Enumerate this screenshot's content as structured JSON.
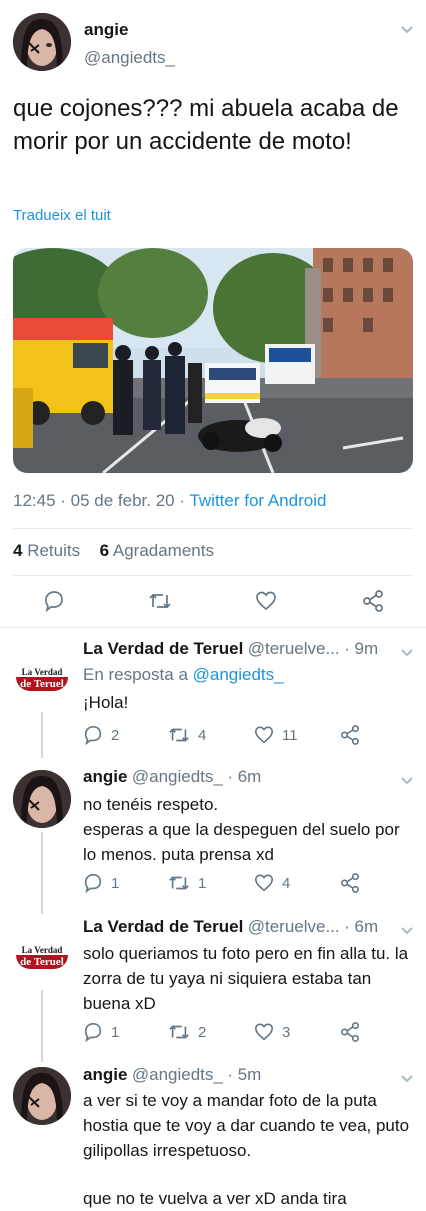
{
  "main_tweet": {
    "name": "angie",
    "handle": "@angiedts_",
    "text": "que cojones??? mi abuela acaba de morir por un accidente de moto!",
    "translate": "Tradueix el tuit",
    "image_alt": "accident scene with ambulance, police and motorcycle on street",
    "time": "12:45 · 05 de febr. 20 · ",
    "source": "Twitter for Android",
    "retweets_count": "4",
    "retweets_label": "Retuits",
    "likes_count": "6",
    "likes_label": "Agradaments"
  },
  "replies": [
    {
      "name": "La Verdad de Teruel",
      "handle": "@teruelve...",
      "time": "· 9m",
      "reply_to_prefix": "En resposta a ",
      "reply_to": "@angiedts_",
      "text": "¡Hola!",
      "replies": "2",
      "retweets": "4",
      "likes": "11"
    },
    {
      "name": "angie",
      "handle": "@angiedts_",
      "time": "· 6m",
      "text": "no tenéis respeto.\nesperas a que la despeguen del suelo por lo menos. puta prensa xd",
      "replies": "1",
      "retweets": "1",
      "likes": "4"
    },
    {
      "name": "La Verdad de Teruel",
      "handle": "@teruelve...",
      "time": "· 6m",
      "text": "solo queriamos tu foto pero en fin alla tu. la zorra de tu yaya ni siquiera estaba tan buena xD",
      "replies": "1",
      "retweets": "2",
      "likes": "3"
    },
    {
      "name": "angie",
      "handle": "@angiedts_",
      "time": "· 5m",
      "text": "a ver si te voy a mandar foto de la puta hostia que te voy a dar cuando te vea, puto gilipollas irrespetuoso.",
      "text2": "que no te vuelva a ver xD anda tira"
    }
  ],
  "logo": {
    "line1": "La Verdad",
    "line2": "de Teruel"
  },
  "colors": {
    "link": "#1b95e0",
    "secondary": "#657786",
    "divider": "#e6ecf0",
    "brand_red": "#b3121f"
  }
}
